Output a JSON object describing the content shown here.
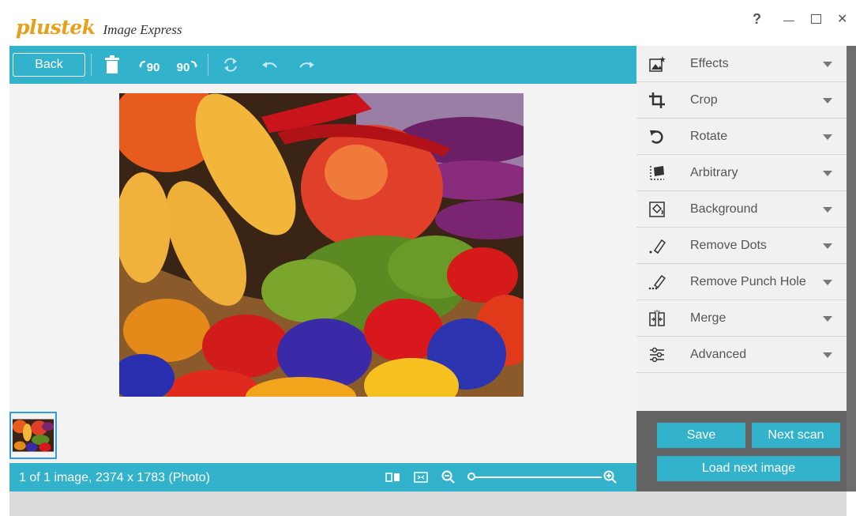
{
  "app": {
    "brand": "plustek",
    "product": "Image Express",
    "help_label": "?",
    "minimize_label": "—",
    "close_label": "✕"
  },
  "toolbar": {
    "back_label": "Back",
    "rotate_left_label": "90",
    "rotate_right_label": "90"
  },
  "panel": {
    "items": [
      {
        "label": "Effects",
        "icon": "effects-icon"
      },
      {
        "label": "Crop",
        "icon": "crop-icon"
      },
      {
        "label": "Rotate",
        "icon": "rotate-icon"
      },
      {
        "label": "Arbitrary",
        "icon": "arbitrary-icon"
      },
      {
        "label": "Background",
        "icon": "background-icon"
      },
      {
        "label": "Remove Dots",
        "icon": "remove-dots-icon"
      },
      {
        "label": "Remove Punch Hole",
        "icon": "remove-punch-hole-icon"
      },
      {
        "label": "Merge",
        "icon": "merge-icon"
      },
      {
        "label": "Advanced",
        "icon": "advanced-icon"
      }
    ]
  },
  "actions": {
    "save_label": "Save",
    "next_scan_label": "Next scan",
    "load_next_label": "Load next image"
  },
  "status": {
    "text": "1 of 1 image, 2374 x 1783 (Photo)",
    "zoom_level": 0
  },
  "colors": {
    "accent": "#32b2cb",
    "brand": "#e8a01c",
    "panel_dark": "#646464"
  }
}
